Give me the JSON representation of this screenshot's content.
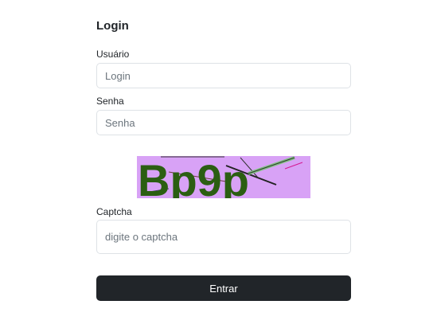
{
  "form": {
    "title": "Login",
    "username": {
      "label": "Usuário",
      "placeholder": "Login",
      "value": ""
    },
    "password": {
      "label": "Senha",
      "placeholder": "Senha",
      "value": ""
    },
    "captcha_image": {
      "text": "Bp9p",
      "background_color": "#d8a2f6",
      "text_color": "#2b5e12"
    },
    "captcha": {
      "label": "Captcha",
      "placeholder": "digite o captcha",
      "value": ""
    },
    "submit_label": "Entrar"
  },
  "colors": {
    "button_bg": "#212529",
    "border": "#dee2e6",
    "placeholder": "#6c757d"
  }
}
